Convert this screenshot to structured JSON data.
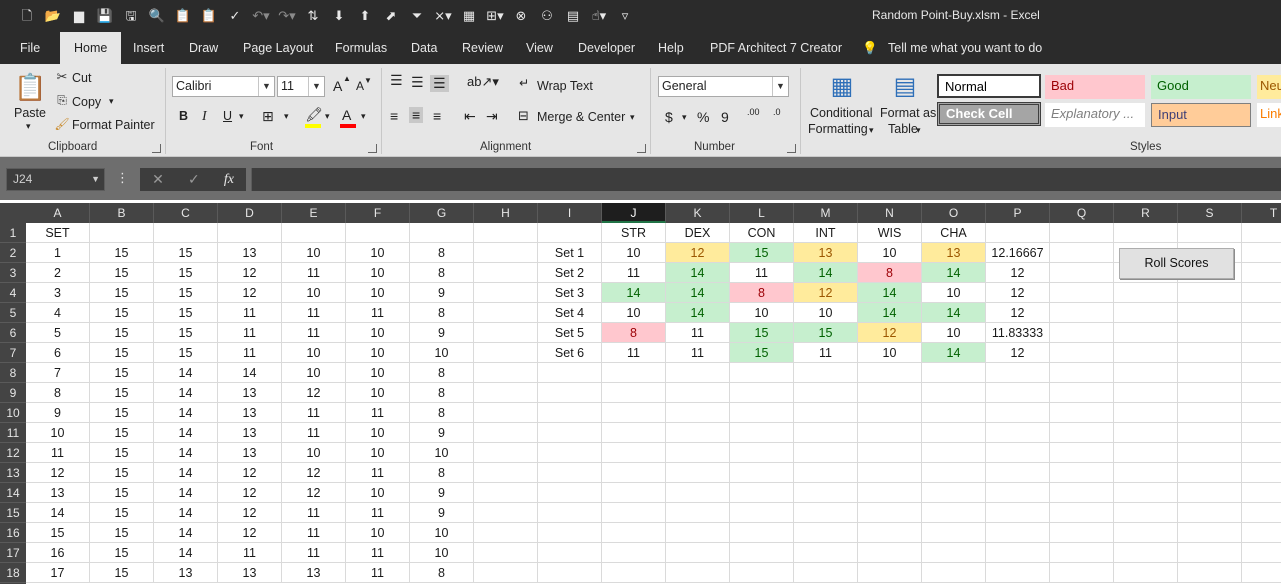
{
  "window": {
    "title": "Random Point-Buy.xlsm  -  Excel"
  },
  "quick_access": {
    "icons": [
      "new-file-icon",
      "open-icon",
      "open-folder-icon",
      "save-icon",
      "save-as-icon",
      "print-preview-icon",
      "paste-special-icon",
      "paste-values-icon",
      "spelling-icon",
      "undo-icon",
      "redo-icon",
      "sort-ascending-icon",
      "import-icon",
      "export-icon",
      "export-alt-icon",
      "filter-icon",
      "clear-filter-icon",
      "calculator-icon",
      "grid-options-icon",
      "remove-icon",
      "add-user-icon",
      "form-icon",
      "touch-mode-icon",
      "customize-qat-icon"
    ]
  },
  "menu_tabs": [
    "File",
    "Home",
    "Insert",
    "Draw",
    "Page Layout",
    "Formulas",
    "Data",
    "Review",
    "View",
    "Developer",
    "Help",
    "PDF Architect 7 Creator"
  ],
  "tell_me": "Tell me what you want to do",
  "ribbon": {
    "clipboard": {
      "paste": "Paste",
      "cut": "Cut",
      "copy": "Copy",
      "format_painter": "Format Painter",
      "label": "Clipboard"
    },
    "font": {
      "name": "Calibri",
      "size": "11",
      "grow": "A",
      "shrink": "A",
      "bold": "B",
      "italic": "I",
      "underline": "U",
      "font_color_glyph": "A",
      "label": "Font"
    },
    "alignment": {
      "wrap_text": "Wrap Text",
      "merge_center": "Merge & Center",
      "label": "Alignment"
    },
    "number": {
      "format": "General",
      "currency": "$",
      "percent": "%",
      "comma": "9",
      "inc_decimal": ".00",
      "dec_decimal": ".0",
      "label": "Number"
    },
    "styles": {
      "conditional_formatting": [
        "Conditional",
        "Formatting"
      ],
      "format_as_table": [
        "Format as",
        "Table"
      ],
      "cells": [
        {
          "text": "Normal",
          "kind": "normal"
        },
        {
          "text": "Bad",
          "kind": "bad"
        },
        {
          "text": "Good",
          "kind": "good"
        },
        {
          "text": "Neu",
          "kind": "neutral"
        },
        {
          "text": "Check Cell",
          "kind": "check"
        },
        {
          "text": "Explanatory ...",
          "kind": "explanatory"
        },
        {
          "text": "Input",
          "kind": "input"
        },
        {
          "text": "Link",
          "kind": "link"
        }
      ],
      "label": "Styles"
    }
  },
  "formula_bar": {
    "name_box": "J24",
    "fx": "fx",
    "cancel": "✕",
    "enter": "✓",
    "value": ""
  },
  "colors": {
    "good_fill": "#c6efce",
    "good_text": "#006100",
    "bad_fill": "#ffc7ce",
    "bad_text": "#9c0006",
    "neutral_fill": "#ffeb9c",
    "neutral_text": "#9c5700",
    "selected_header_accent": "#217346"
  },
  "sheet": {
    "selected_column": "J",
    "columns": [
      "A",
      "B",
      "C",
      "D",
      "E",
      "F",
      "G",
      "H",
      "I",
      "J",
      "K",
      "L",
      "M",
      "N",
      "O",
      "P",
      "Q",
      "R",
      "S",
      "T"
    ],
    "rows": [
      "1",
      "2",
      "3",
      "4",
      "5",
      "6",
      "7",
      "8",
      "9",
      "10",
      "11",
      "12",
      "13",
      "14",
      "15",
      "16",
      "17",
      "18"
    ],
    "set_header": "SET",
    "set_rows": [
      [
        "1",
        "15",
        "15",
        "13",
        "10",
        "10",
        "8"
      ],
      [
        "2",
        "15",
        "15",
        "12",
        "11",
        "10",
        "8"
      ],
      [
        "3",
        "15",
        "15",
        "12",
        "10",
        "10",
        "9"
      ],
      [
        "4",
        "15",
        "15",
        "11",
        "11",
        "11",
        "8"
      ],
      [
        "5",
        "15",
        "15",
        "11",
        "11",
        "10",
        "9"
      ],
      [
        "6",
        "15",
        "15",
        "11",
        "10",
        "10",
        "10"
      ],
      [
        "7",
        "15",
        "14",
        "14",
        "10",
        "10",
        "8"
      ],
      [
        "8",
        "15",
        "14",
        "13",
        "12",
        "10",
        "8"
      ],
      [
        "9",
        "15",
        "14",
        "13",
        "11",
        "11",
        "8"
      ],
      [
        "10",
        "15",
        "14",
        "13",
        "11",
        "10",
        "9"
      ],
      [
        "11",
        "15",
        "14",
        "13",
        "10",
        "10",
        "10"
      ],
      [
        "12",
        "15",
        "14",
        "12",
        "12",
        "11",
        "8"
      ],
      [
        "13",
        "15",
        "14",
        "12",
        "12",
        "10",
        "9"
      ],
      [
        "14",
        "15",
        "14",
        "12",
        "11",
        "11",
        "9"
      ],
      [
        "15",
        "15",
        "14",
        "12",
        "11",
        "10",
        "10"
      ],
      [
        "16",
        "15",
        "14",
        "11",
        "11",
        "11",
        "10"
      ],
      [
        "17",
        "15",
        "13",
        "13",
        "13",
        "11",
        "8"
      ]
    ],
    "score_headers": [
      "STR",
      "DEX",
      "CON",
      "INT",
      "WIS",
      "CHA"
    ],
    "score_sets": [
      {
        "label": "Set 1",
        "avg": "12.16667",
        "scores": [
          {
            "v": "10",
            "s": "plain"
          },
          {
            "v": "12",
            "s": "neutral"
          },
          {
            "v": "15",
            "s": "good"
          },
          {
            "v": "13",
            "s": "neutral"
          },
          {
            "v": "10",
            "s": "plain"
          },
          {
            "v": "13",
            "s": "neutral"
          }
        ]
      },
      {
        "label": "Set 2",
        "avg": "12",
        "scores": [
          {
            "v": "11",
            "s": "plain"
          },
          {
            "v": "14",
            "s": "good"
          },
          {
            "v": "11",
            "s": "plain"
          },
          {
            "v": "14",
            "s": "good"
          },
          {
            "v": "8",
            "s": "bad"
          },
          {
            "v": "14",
            "s": "good"
          }
        ]
      },
      {
        "label": "Set 3",
        "avg": "12",
        "scores": [
          {
            "v": "14",
            "s": "good"
          },
          {
            "v": "14",
            "s": "good"
          },
          {
            "v": "8",
            "s": "bad"
          },
          {
            "v": "12",
            "s": "neutral"
          },
          {
            "v": "14",
            "s": "good"
          },
          {
            "v": "10",
            "s": "plain"
          }
        ]
      },
      {
        "label": "Set 4",
        "avg": "12",
        "scores": [
          {
            "v": "10",
            "s": "plain"
          },
          {
            "v": "14",
            "s": "good"
          },
          {
            "v": "10",
            "s": "plain"
          },
          {
            "v": "10",
            "s": "plain"
          },
          {
            "v": "14",
            "s": "good"
          },
          {
            "v": "14",
            "s": "good"
          }
        ]
      },
      {
        "label": "Set 5",
        "avg": "11.83333",
        "scores": [
          {
            "v": "8",
            "s": "bad"
          },
          {
            "v": "11",
            "s": "plain"
          },
          {
            "v": "15",
            "s": "good"
          },
          {
            "v": "15",
            "s": "good"
          },
          {
            "v": "12",
            "s": "neutral"
          },
          {
            "v": "10",
            "s": "plain"
          }
        ]
      },
      {
        "label": "Set 6",
        "avg": "12",
        "scores": [
          {
            "v": "11",
            "s": "plain"
          },
          {
            "v": "11",
            "s": "plain"
          },
          {
            "v": "15",
            "s": "good"
          },
          {
            "v": "11",
            "s": "plain"
          },
          {
            "v": "10",
            "s": "plain"
          },
          {
            "v": "14",
            "s": "good"
          }
        ]
      }
    ],
    "roll_button": "Roll Scores"
  }
}
